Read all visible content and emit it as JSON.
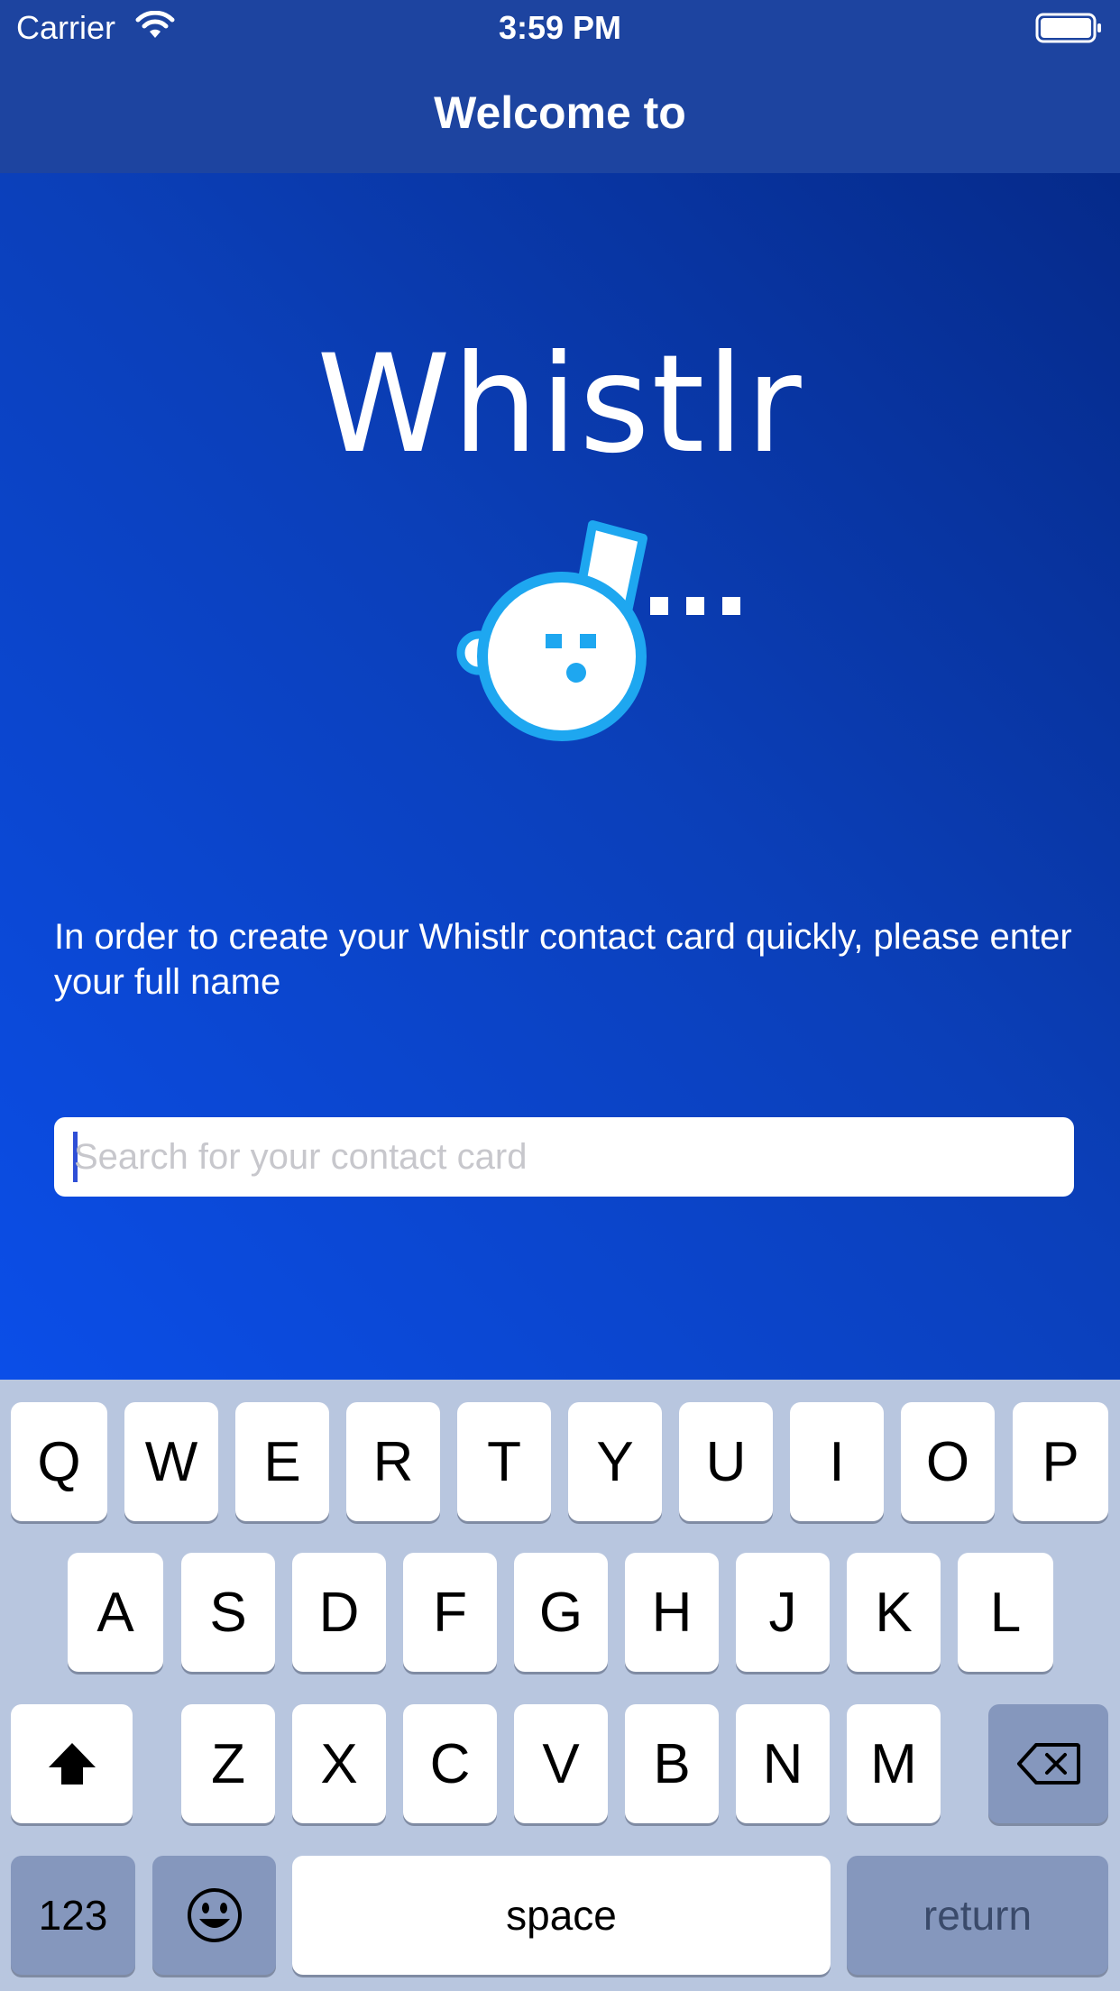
{
  "status_bar": {
    "carrier": "Carrier",
    "time": "3:59 PM"
  },
  "nav": {
    "title": "Welcome to"
  },
  "app": {
    "name": "Whistlr",
    "intro_text": "In order to create your Whistlr contact card quickly, please enter your full name",
    "search_placeholder": "Search for your contact card",
    "search_value": ""
  },
  "keyboard": {
    "row1": [
      "Q",
      "W",
      "E",
      "R",
      "T",
      "Y",
      "U",
      "I",
      "O",
      "P"
    ],
    "row2": [
      "A",
      "S",
      "D",
      "F",
      "G",
      "H",
      "J",
      "K",
      "L"
    ],
    "row3": [
      "Z",
      "X",
      "C",
      "V",
      "B",
      "N",
      "M"
    ],
    "numbers_label": "123",
    "space_label": "space",
    "return_label": "return",
    "shift_icon": "shift-arrow-icon",
    "delete_icon": "backspace-icon",
    "emoji_icon": "emoji-icon"
  },
  "colors": {
    "header": "#1d44a0",
    "gradient_dark": "#052a8a",
    "gradient_light": "#0b4ee8",
    "logo_accent": "#1ea7f0",
    "keyboard_bg": "#b8c6df",
    "key_dark": "#8597bd"
  }
}
